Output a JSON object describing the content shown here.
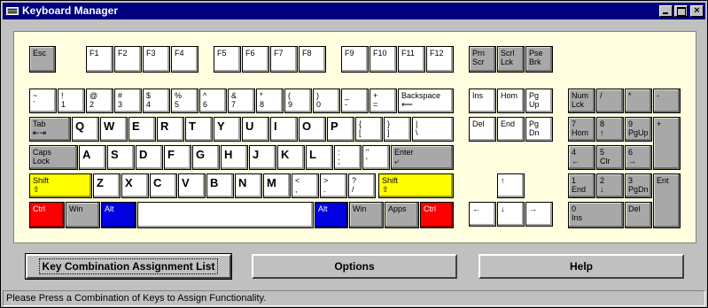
{
  "window": {
    "title": "Keyboard Manager",
    "close_label": "×"
  },
  "keys": {
    "esc": "Esc",
    "f1": "F1",
    "f2": "F2",
    "f3": "F3",
    "f4": "F4",
    "f5": "F5",
    "f6": "F6",
    "f7": "F7",
    "f8": "F8",
    "f9": "F9",
    "f10": "F10",
    "f11": "F11",
    "f12": "F12",
    "prnscr": "Prn\nScr",
    "scrllck": "Scrl\nLck",
    "psebrk": "Pse\nBrk",
    "tilde": "~\n`",
    "k1": "!\n1",
    "k2": "@\n2",
    "k3": "#\n3",
    "k4": "$\n4",
    "k5": "%\n5",
    "k6": "^\n6",
    "k7": "&\n7",
    "k8": "*\n8",
    "k9": "(\n9",
    "k0": ")\n0",
    "minus": "_\n-",
    "equals": "+\n=",
    "backspace": "Backspace\n⟵",
    "tab": "Tab\n⇤⇥",
    "q": "Q",
    "w": "W",
    "e": "E",
    "r": "R",
    "t": "T",
    "y": "Y",
    "u": "U",
    "i": "I",
    "o": "O",
    "p": "P",
    "lbrace": "{\n[",
    "rbrace": "}\n]",
    "backslash": "|\n\\",
    "capslock": "Caps\nLock",
    "a": "A",
    "s": "S",
    "d": "D",
    "f": "F",
    "g": "G",
    "h": "H",
    "j": "J",
    "k": "K",
    "l": "L",
    "semicolon": ":\n;",
    "quote": "\"\n'",
    "enter": "Enter\n⤶",
    "lshift": "Shift\n⇧",
    "z": "Z",
    "x": "X",
    "c": "C",
    "v": "V",
    "b": "B",
    "n": "N",
    "m": "M",
    "comma": "<\n,",
    "period": ">\n.",
    "slash": "?\n/",
    "rshift": "Shift\n⇧",
    "lctrl": "Ctrl",
    "lwin": "Win",
    "lalt": "Alt",
    "space": "",
    "ralt": "Alt",
    "rwin": "Win",
    "apps": "Apps",
    "rctrl": "Ctrl",
    "ins": "Ins",
    "home": "Hom",
    "pgup": "Pg\nUp",
    "del": "Del",
    "end": "End",
    "pgdn": "Pg\nDn",
    "up": "↑",
    "left": "←",
    "down": "↓",
    "right": "→",
    "numlck": "Num\nLck",
    "npdiv": "/",
    "npmul": "*",
    "npminus": "-",
    "np7": "7\nHom",
    "np8": "8\n↑",
    "np9": "9\nPgUp",
    "npplus": "+",
    "np4": "4\n←",
    "np5": "5\nClr",
    "np6": "6\n→",
    "np1": "1\nEnd",
    "np2": "2\n↓",
    "np3": "3\nPgDn",
    "npent": "Ent",
    "np0": "0\nIns",
    "npdel": "Del"
  },
  "buttons": {
    "assignment_list": "Key Combination Assignment List",
    "options": "Options",
    "help": "Help"
  },
  "status": "Please Press a Combination of Keys to Assign Functionality."
}
